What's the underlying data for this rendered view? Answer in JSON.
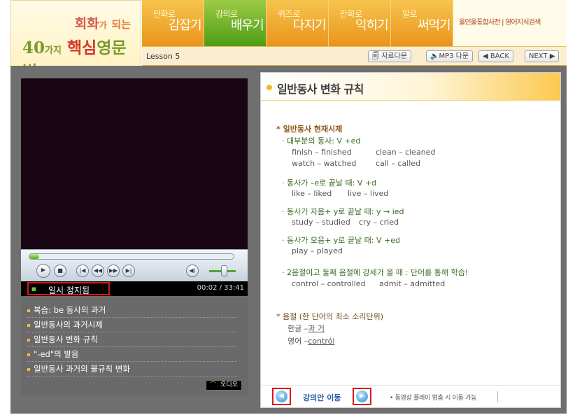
{
  "header": {
    "logo": {
      "line1_main": "회화",
      "line1_small": "가",
      "line1_end": "되는",
      "line2_num": "40",
      "line2_small": "가지",
      "line2_core": "핵심",
      "line2_end": "영문법"
    },
    "tabs": [
      {
        "line1": "만화로",
        "line2": "감잡기"
      },
      {
        "line1": "강의로",
        "line2": "배우기"
      },
      {
        "line1": "퀴즈로",
        "line2": "다지기"
      },
      {
        "line1": "만화로",
        "line2": "익히기"
      },
      {
        "line1": "말로",
        "line2": "써먹기"
      }
    ],
    "search_label": "올인올통합사전 | 영어지식검색",
    "lesson": "Lesson 5",
    "buttons": {
      "download": "자료다운",
      "mp3": "MP3 다운",
      "back": "◀ BACK",
      "next": "NEXT ▶"
    }
  },
  "player": {
    "progress": 0.04,
    "status": "일시 정지됨",
    "timecode": "00:02 / 33:41",
    "audio_label": "오디오",
    "playlist": [
      "복습: be 동사의 과거",
      "일반동사의 과거시제",
      "일반동사 변화 규칙",
      "\"-ed\"의 발음",
      "일반동사 과거의 불규칙 변화"
    ]
  },
  "lecture": {
    "title": "일반동사 변화 규칙",
    "section1_heading": "* 일반동사 현재시제",
    "rule1": "· 대부분의 동사: V +ed",
    "rule1_ex1": [
      "finish – finished",
      "clean – cleaned"
    ],
    "rule1_ex2": [
      "watch – watched",
      "call – called"
    ],
    "rule2": "· 동사가 –e로 끝날 때: V +d",
    "rule2_ex": [
      "like – liked",
      "live – lived"
    ],
    "rule3": "· 동사가 자음+ y로 끝날 때: y → ied",
    "rule3_ex": [
      "study – studied",
      "cry – cried"
    ],
    "rule4": "· 동사가 모음+ y로 끝날 때: V +ed",
    "rule4_ex": "play – played",
    "rule5": "· 2음절이고 둘째 음절에 강세가 올 때 : 단어를 통해 학습!",
    "rule5_ex": [
      "control – controlled",
      "admit – admitted"
    ],
    "section2_heading": "* 음절 (한 단어의 최소 소리단위)",
    "korean_prefix": "한글 – ",
    "korean_word": "과 거",
    "english_prefix": "영어 – ",
    "english_word": "contról",
    "nav_label": "강의안 이동",
    "nav_note": "• 동영상 플레이 멈춤 시 이동 가능"
  }
}
